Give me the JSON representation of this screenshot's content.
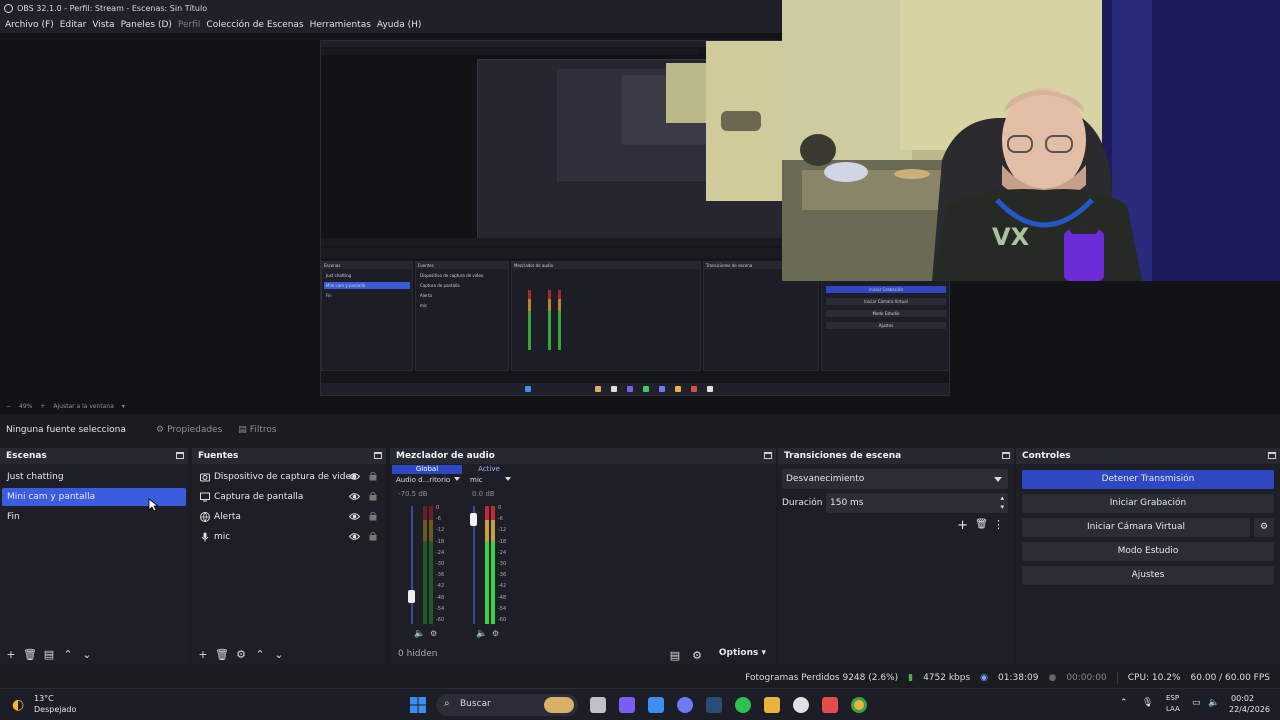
{
  "window": {
    "title": "OBS 32.1.0 - Perfil: Stream - Escenas: Sin Título"
  },
  "menu": [
    {
      "label": "Archivo (F)",
      "enabled": true
    },
    {
      "label": "Editar",
      "enabled": true
    },
    {
      "label": "Vista",
      "enabled": true
    },
    {
      "label": "Paneles (D)",
      "enabled": true
    },
    {
      "label": "Perfil",
      "enabled": false
    },
    {
      "label": "Colección de Escenas",
      "enabled": true
    },
    {
      "label": "Herramientas",
      "enabled": true
    },
    {
      "label": "Ayuda (H)",
      "enabled": true
    }
  ],
  "preview": {
    "zoom": "49%",
    "fit_label": "Ajustar a la ventana"
  },
  "source_toolbar": {
    "no_source": "Ninguna fuente selecciona",
    "properties": "Propiedades",
    "filters": "Filtros"
  },
  "scenes": {
    "title": "Escenas",
    "items": [
      "Just chatting",
      "Mini cam y pantalla",
      "Fin"
    ],
    "selected_index": 1
  },
  "sources": {
    "title": "Fuentes",
    "items": [
      {
        "label": "Dispositivo de captura de video",
        "icon": "camera-icon"
      },
      {
        "label": "Captura de pantalla",
        "icon": "monitor-icon"
      },
      {
        "label": "Alerta",
        "icon": "globe-icon"
      },
      {
        "label": "mic",
        "icon": "microphone-icon"
      }
    ]
  },
  "mixer": {
    "title": "Mezclador de audio",
    "tabs": [
      "Global",
      "Active"
    ],
    "channels": [
      {
        "name": "Audio d...ritorio",
        "db": "-70.5 dB",
        "fader_level": 0.2
      },
      {
        "name": "mic",
        "db": "0.0 dB",
        "fader_level": 0.93
      }
    ],
    "scale": [
      "0",
      "-6",
      "-12",
      "-18",
      "-24",
      "-30",
      "-36",
      "-42",
      "-48",
      "-54",
      "-60"
    ],
    "hidden": "0 hidden",
    "options": "Options"
  },
  "transitions": {
    "title": "Transiciones de escena",
    "current": "Desvanecimiento",
    "duration_label": "Duración",
    "duration_value": "150 ms"
  },
  "controls": {
    "title": "Controles",
    "buttons": [
      "Detener Transmisión",
      "Iniciar Grabación",
      "Iniciar Cámara Virtual",
      "Modo Estudio",
      "Ajustes"
    ]
  },
  "status": {
    "dropped": "Fotogramas Perdidos 9248 (2.6%)",
    "bitrate": "4752 kbps",
    "stream_time": "01:38:09",
    "rec_time": "00:00:00",
    "cpu": "CPU: 10.2%",
    "fps": "60.00 / 60.00 FPS"
  },
  "taskbar": {
    "weather_temp": "13°C",
    "weather_desc": "Despejado",
    "search": "Buscar",
    "lang": "ESP",
    "layout": "LAA",
    "time": "00:02",
    "date": "22/4/2026"
  },
  "colors": {
    "accent": "#3c5ce0",
    "primary_button": "#2f47c2",
    "panel": "#1e1f26",
    "title": "#272832"
  }
}
